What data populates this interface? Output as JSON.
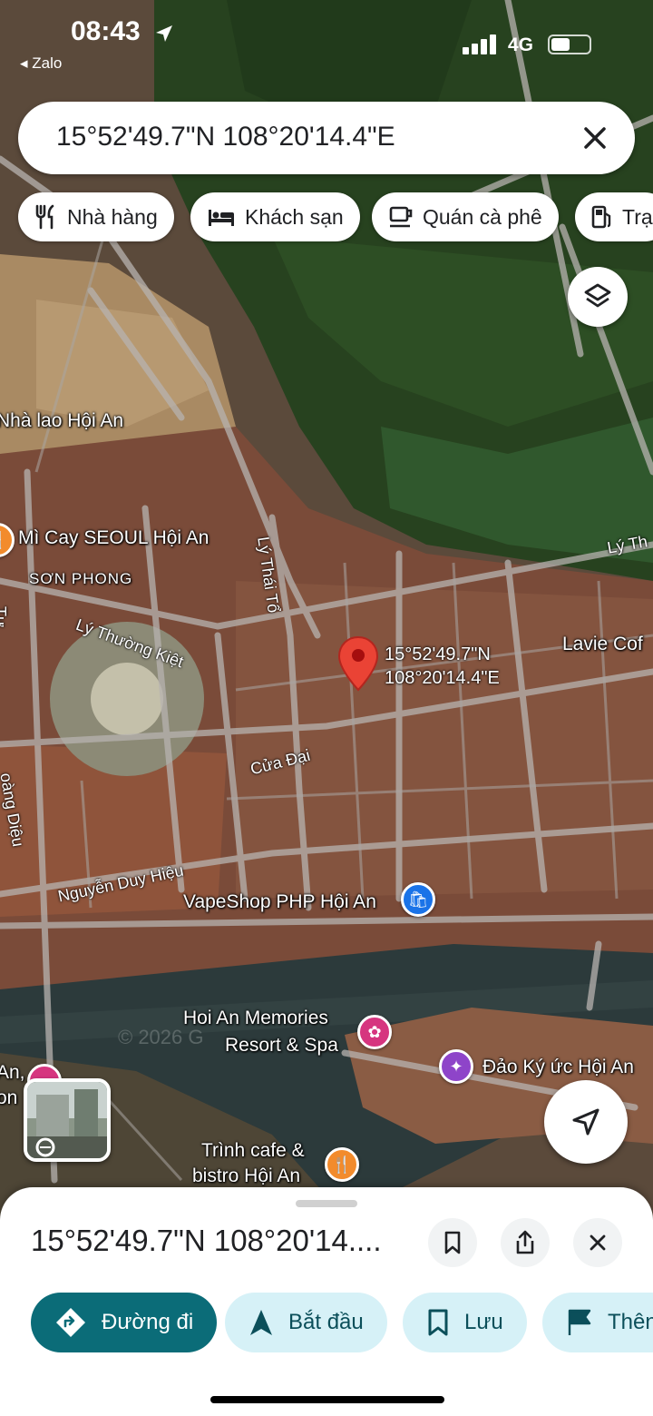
{
  "status_bar": {
    "time": "08:43",
    "back_app": "◂ Zalo",
    "network": "4G"
  },
  "search": {
    "query": "15°52'49.7\"N 108°20'14.4\"E"
  },
  "chips": [
    {
      "label": "Nhà hàng",
      "icon": "fork-knife-icon"
    },
    {
      "label": "Khách sạn",
      "icon": "bed-icon"
    },
    {
      "label": "Quán cà phê",
      "icon": "coffee-cup-icon"
    },
    {
      "label": "Trạ",
      "icon": "gas-pump-icon"
    }
  ],
  "map": {
    "places": {
      "nha_lao": "Nhà lao Hội An",
      "mi_cay": "Mì Cay SEOUL Hội An",
      "son_phong": "SƠN PHONG",
      "lavie": "Lavie Cof",
      "vapeshop": "VapeShop PHP Hội An",
      "hoi_an_memories_1": "Hoi An Memories",
      "hoi_an_memories_2": "Resort & Spa",
      "dao_ky_uc": "Đảo Ký ức Hội An",
      "trinh_cafe_1": "Trình cafe &",
      "trinh_cafe_2": "bistro Hội An",
      "edge_an": "An,",
      "edge_on": "on"
    },
    "roads": {
      "ly_thai_to": "Lý Thái Tổ",
      "ly_thuong_kiet": "Lý Thường Kiệt",
      "cua_dai": "Cửa Đại",
      "nguyen_duy_hieu": "Nguyễn Duy Hiệu",
      "hoang_dieu": "oàng Diệu",
      "ly_th": "Lý Th",
      "tu": "Tự"
    },
    "pin_label": {
      "line1": "15°52'49.7\"N",
      "line2": "108°20'14.4\"E"
    },
    "watermark": "© 2026 G"
  },
  "sheet": {
    "title": "15°52'49.7\"N 108°20'14....",
    "actions": [
      {
        "label": "Đường đi",
        "icon": "directions-icon"
      },
      {
        "label": "Bắt đầu",
        "icon": "navigation-arrow-icon"
      },
      {
        "label": "Lưu",
        "icon": "bookmark-icon"
      },
      {
        "label": "Thên",
        "icon": "flag-icon"
      }
    ]
  },
  "colors": {
    "accent": "#0b6c78",
    "pin": "#ea4335",
    "chip_bg": "#ffffff",
    "secondary_btn": "#d6f1f7"
  }
}
